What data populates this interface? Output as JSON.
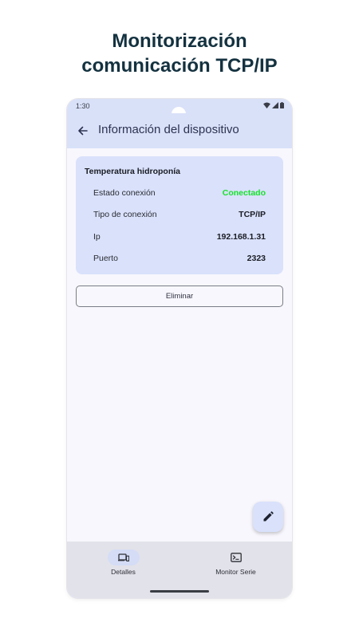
{
  "promo": {
    "title_line1": "Monitorización",
    "title_line2": "comunicación TCP/IP"
  },
  "status_bar": {
    "time": "1:30",
    "icons": [
      "wifi-icon",
      "signal-icon",
      "battery-icon"
    ]
  },
  "top_bar": {
    "back_icon": "arrow-back-icon",
    "title": "Información del dispositivo"
  },
  "device_card": {
    "title": "Temperatura hidroponía",
    "rows": [
      {
        "label": "Estado conexión",
        "value": "Conectado",
        "status_color": "#17e22a"
      },
      {
        "label": "Tipo de conexión",
        "value": "TCP/IP"
      },
      {
        "label": "Ip",
        "value": "192.168.1.31"
      },
      {
        "label": "Puerto",
        "value": "2323"
      }
    ]
  },
  "actions": {
    "delete_label": "Eliminar",
    "edit_icon": "pencil-icon"
  },
  "bottom_nav": {
    "items": [
      {
        "label": "Detalles",
        "icon": "devices-icon",
        "active": true
      },
      {
        "label": "Monitor Serie",
        "icon": "terminal-icon",
        "active": false
      }
    ]
  },
  "colors": {
    "accent_surface": "#d9e1f9",
    "title_text": "#143240",
    "connected_green": "#17e22a"
  }
}
